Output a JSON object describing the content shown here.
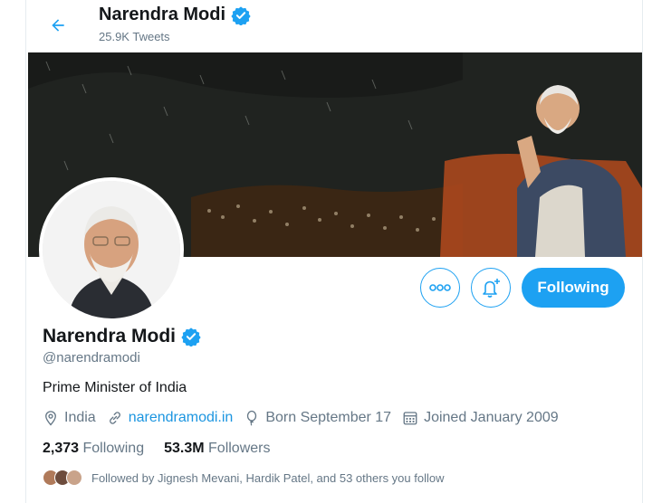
{
  "header": {
    "name": "Narendra Modi",
    "tweet_count": "25.9K Tweets"
  },
  "icons": {
    "back": "arrow-left-icon",
    "verified": "verified-badge-icon",
    "more": "more-dots-icon",
    "notify": "bell-plus-icon",
    "location": "location-pin-icon",
    "link": "link-icon",
    "birthday": "balloon-icon",
    "calendar": "calendar-icon"
  },
  "colors": {
    "accent": "#1da1f2",
    "link": "#1b95e0",
    "secondary_text": "#657786"
  },
  "actions": {
    "following_label": "Following"
  },
  "profile": {
    "name": "Narendra Modi",
    "handle": "@narendramodi",
    "bio": "Prime Minister of India",
    "location": "India",
    "website": "narendramodi.in",
    "born": "Born September 17",
    "joined": "Joined January 2009",
    "following_count": "2,373",
    "following_label": "Following",
    "followers_count": "53.3M",
    "followers_label": "Followers",
    "followed_by": "Followed by Jignesh Mevani, Hardik Patel, and 53 others you follow"
  }
}
